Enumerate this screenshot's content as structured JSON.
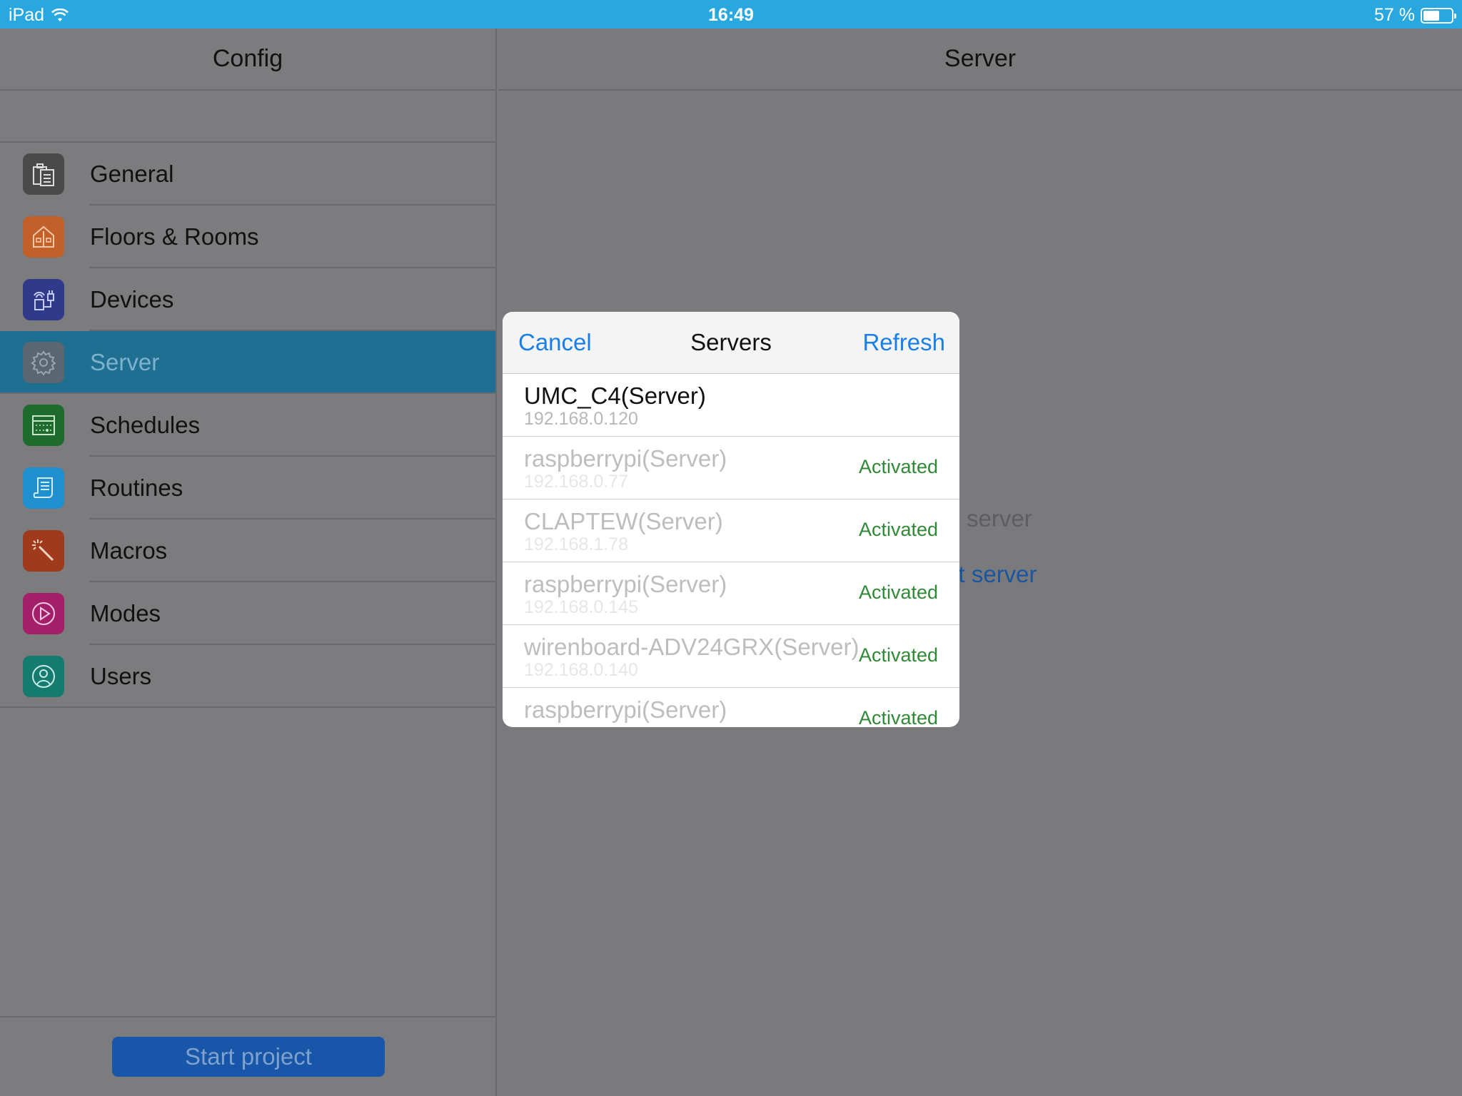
{
  "status_bar": {
    "device": "iPad",
    "time": "16:49",
    "battery": "57 %",
    "battery_level": 0.57
  },
  "left_panel": {
    "title": "Config",
    "menu": [
      {
        "label": "General",
        "icon": "clipboard-icon",
        "color": "#4a4a4a"
      },
      {
        "label": "Floors & Rooms",
        "icon": "house-icon",
        "color": "#c2602a"
      },
      {
        "label": "Devices",
        "icon": "devices-icon",
        "color": "#2f3a8a"
      },
      {
        "label": "Server",
        "icon": "gear-icon",
        "color": "#5a6670",
        "active": true
      },
      {
        "label": "Schedules",
        "icon": "calendar-icon",
        "color": "#1f6b2e"
      },
      {
        "label": "Routines",
        "icon": "scroll-icon",
        "color": "#1f8fce"
      },
      {
        "label": "Macros",
        "icon": "magic-wand-icon",
        "color": "#a03a1c"
      },
      {
        "label": "Modes",
        "icon": "play-circle-icon",
        "color": "#a31f6a"
      },
      {
        "label": "Users",
        "icon": "user-icon",
        "color": "#157a70"
      }
    ],
    "start_button": "Start project"
  },
  "right_panel": {
    "title": "Server",
    "behind_text_1": "server",
    "behind_text_2": "ct server"
  },
  "servers_popover": {
    "cancel": "Cancel",
    "title": "Servers",
    "refresh": "Refresh",
    "servers": [
      {
        "name": "UMC_C4(Server)",
        "ip": "192.168.0.120",
        "status": ""
      },
      {
        "name": "raspberrypi(Server)",
        "ip": "192.168.0.77",
        "status": "Activated"
      },
      {
        "name": "CLAPTEW(Server)",
        "ip": "192.168.1.78",
        "status": "Activated"
      },
      {
        "name": "raspberrypi(Server)",
        "ip": "192.168.0.145",
        "status": "Activated"
      },
      {
        "name": "wirenboard-ADV24GRX(Server)",
        "ip": "192.168.0.140",
        "status": "Activated"
      },
      {
        "name": "raspberrypi(Server)",
        "ip": "",
        "status": "Activated"
      }
    ]
  }
}
